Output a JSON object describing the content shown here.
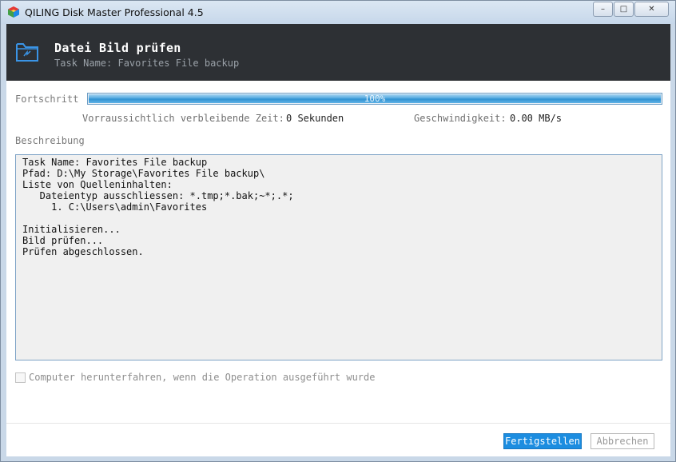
{
  "window": {
    "title": "QILING Disk Master Professional 4.5",
    "controls": {
      "minimize": "–",
      "maximize": "□",
      "close": "✕"
    }
  },
  "header": {
    "title": "Datei Bild prüfen",
    "subtitle": "Task Name: Favorites File backup",
    "icon": "folder-sync-icon"
  },
  "progress": {
    "label": "Fortschritt",
    "value": 100,
    "text": "100%"
  },
  "stats": {
    "time_label": "Vorraussichtlich verbleibende Zeit:",
    "time_value": "0 Sekunden",
    "speed_label": "Geschwindigkeit:",
    "speed_value": "0.00 MB/s"
  },
  "description": {
    "label": "Beschreibung",
    "lines": [
      "Task Name: Favorites File backup",
      "Pfad: D:\\My Storage\\Favorites File backup\\",
      "Liste von Quelleninhalten:",
      "   Dateientyp ausschliessen: *.tmp;*.bak;~*;.*;",
      "     1. C:\\Users\\admin\\Favorites",
      "",
      "Initialisieren...",
      "Bild prüfen...",
      "Prüfen abgeschlossen."
    ]
  },
  "shutdown": {
    "label": "Computer herunterfahren, wenn die Operation ausgeführt wurde",
    "checked": false
  },
  "buttons": {
    "finish": "Fertigstellen",
    "cancel": "Abbrechen"
  },
  "colors": {
    "header_bg": "#2d3034",
    "accent": "#1c8de0",
    "frame": "#c9d8e8"
  }
}
